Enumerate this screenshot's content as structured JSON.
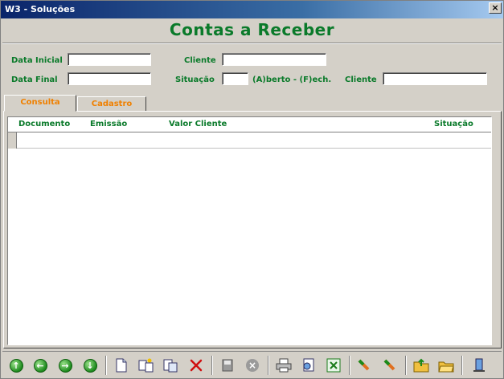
{
  "window": {
    "title": "W3 - Soluções",
    "close_glyph": "×"
  },
  "heading": "Contas a Receber",
  "filters": {
    "data_inicial_label": "Data Inicial",
    "data_final_label": "Data Final",
    "cliente_label": "Cliente",
    "situacao_label": "Situação",
    "situacao_hint": "(A)berto - (F)ech.",
    "cliente2_label": "Cliente",
    "data_inicial_value": "",
    "data_final_value": "",
    "cliente_value": "",
    "situacao_value": "",
    "cliente2_value": ""
  },
  "tabs": [
    {
      "label": "Consulta"
    },
    {
      "label": "Cadastro"
    }
  ],
  "grid": {
    "columns": [
      "Documento",
      "Emissão",
      "Valor Cliente",
      "Situação"
    ]
  },
  "toolbar": {
    "icons": [
      "arrow-up-icon",
      "arrow-left-icon",
      "arrow-right-icon",
      "arrow-down-icon",
      "new-document-icon",
      "copy-to-icon",
      "paste-icon",
      "delete-icon",
      "save-icon",
      "cancel-icon",
      "print-icon",
      "preview-icon",
      "excel-icon",
      "export-pencil-icon",
      "import-pencil-icon",
      "folder-up-icon",
      "folder-open-icon",
      "exit-icon"
    ],
    "arrow_glyphs": {
      "up": "↑",
      "left": "←",
      "right": "→",
      "down": "↓"
    },
    "cancel_glyph": "×"
  }
}
